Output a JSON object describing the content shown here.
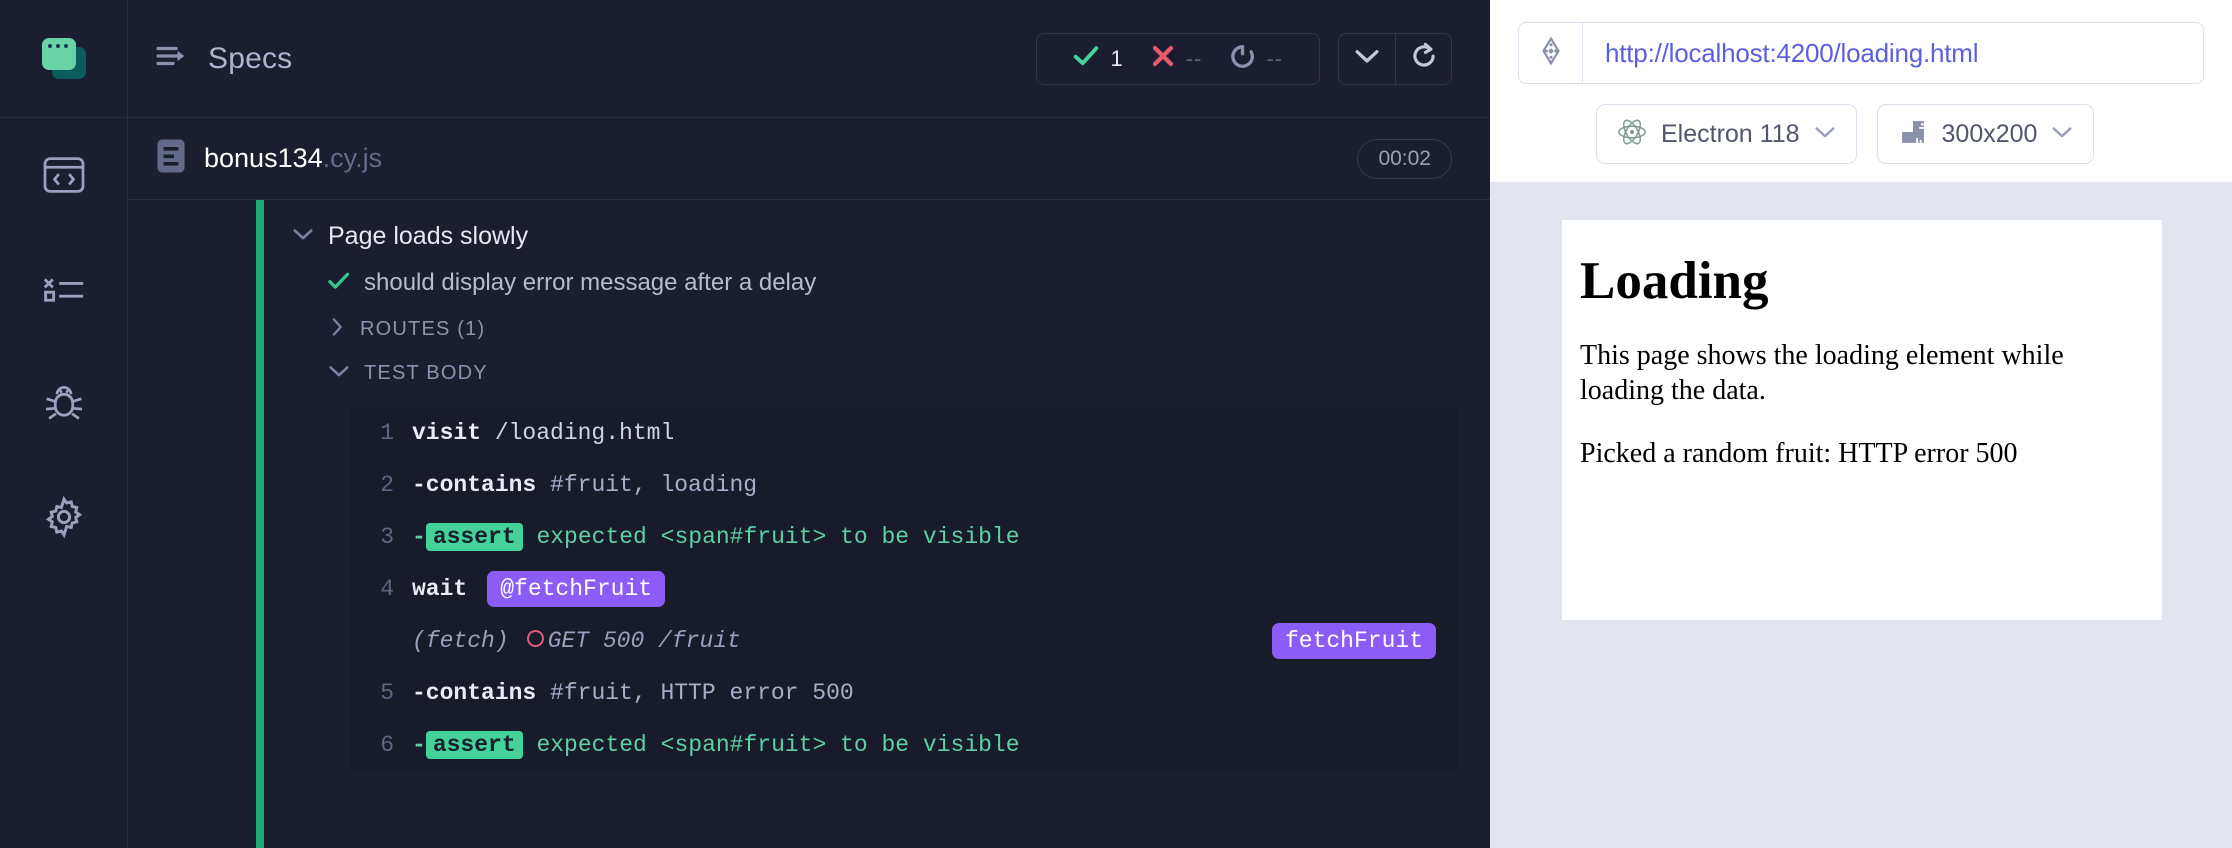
{
  "sidebar": {
    "logo_name": "cypress-logo",
    "items": [
      {
        "name": "specs",
        "icon": "code-window-icon"
      },
      {
        "name": "runs",
        "icon": "test-list-icon"
      },
      {
        "name": "debug",
        "icon": "bug-icon"
      },
      {
        "name": "settings",
        "icon": "gear-icon"
      }
    ]
  },
  "reporter": {
    "header": {
      "title": "Specs",
      "menu_icon": "collapse-arrow-icon"
    },
    "stats": {
      "passed": "1",
      "failed": "--",
      "pending": "--",
      "passed_icon": "check-icon",
      "failed_icon": "x-icon",
      "pending_icon": "pending-circle-icon"
    },
    "controls": {
      "chevron_label": "chevron-down-icon",
      "restart_label": "restart-icon"
    },
    "spec": {
      "file_icon": "file-icon",
      "name": "bonus134",
      "extension": ".cy.js",
      "duration": "00:02"
    },
    "suite": {
      "title": "Page loads slowly",
      "toggle_icon": "chevron-down-icon"
    },
    "test": {
      "title": "should display error message after a delay",
      "status_icon": "check-icon"
    },
    "sections": [
      {
        "label": "ROUTES (1)",
        "toggle_icon": "chevron-right-icon",
        "expanded": false
      },
      {
        "label": "TEST BODY",
        "toggle_icon": "chevron-down-icon",
        "expanded": true
      }
    ],
    "commands": [
      {
        "num": "1",
        "method": "visit",
        "args": " /loading.html",
        "type": "plain"
      },
      {
        "num": "2",
        "method": "-contains",
        "args": " #fruit, loading",
        "type": "plain"
      },
      {
        "num": "3",
        "prefix": "-",
        "chip": "assert",
        "args": " expected <span#fruit> to be visible",
        "type": "assert"
      },
      {
        "num": "4",
        "method": "wait",
        "alias": "@fetchFruit",
        "type": "alias"
      },
      {
        "num": "",
        "fetch_label": "(fetch)",
        "route": "GET 500 /fruit",
        "right_alias": "fetchFruit",
        "type": "route"
      },
      {
        "num": "5",
        "method": "-contains",
        "args": " #fruit, HTTP error 500",
        "type": "plain"
      },
      {
        "num": "6",
        "prefix": "-",
        "chip": "assert",
        "args": " expected <span#fruit> to be visible",
        "type": "assert"
      }
    ]
  },
  "preview": {
    "selector_icon": "selector-playground-icon",
    "url": "http://localhost:4200/loading.html",
    "browser": {
      "icon": "electron-icon",
      "label": "Electron 118",
      "chevron": "chevron-down-icon"
    },
    "viewport": {
      "icon": "ruler-icon",
      "label": "300x200",
      "chevron": "chevron-down-icon"
    },
    "aut": {
      "heading": "Loading",
      "paragraph1": "This page shows the loading element while loading the data.",
      "paragraph2": "Picked a random fruit: HTTP error 500"
    }
  },
  "colors": {
    "pass_green": "#45d19a",
    "fail_red": "#e05c7a",
    "alias_purple": "#8b5cf6",
    "rail_green": "#1fa971",
    "url_blue": "#5a5fe0"
  }
}
